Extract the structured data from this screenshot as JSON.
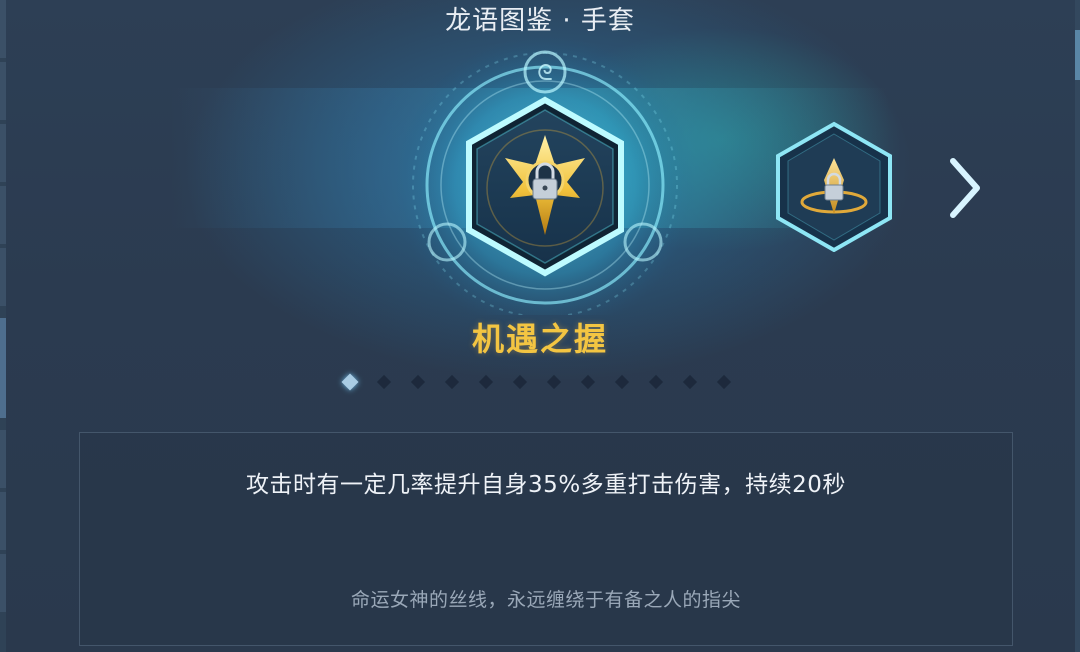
{
  "header": {
    "title": "龙语图鉴 · 手套"
  },
  "item": {
    "name": "机遇之握",
    "effect": "攻击时有一定几率提升自身35%多重打击伤害，持续20秒",
    "flavor": "命运女神的丝线，永远缠绕于有备之人的指尖",
    "locked": true
  },
  "pager": {
    "count": 12,
    "active_index": 0
  },
  "colors": {
    "name_gold": "#f3c542",
    "glow_cyan": "#5fe0f0",
    "active_dot": "#bfe6ff"
  },
  "icons": {
    "main": "glove-emblem-icon",
    "lock": "lock-icon",
    "next": "chevron-right-icon"
  }
}
